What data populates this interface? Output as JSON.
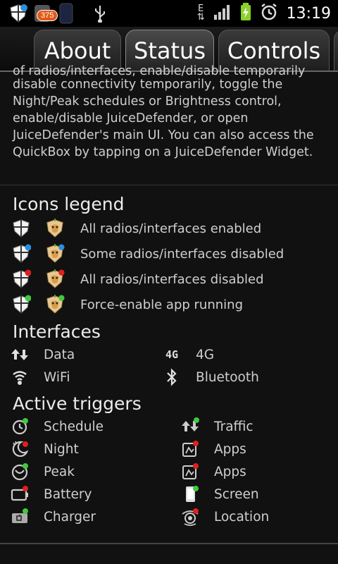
{
  "status_bar": {
    "notification_badge": "375",
    "time": "13:19",
    "network_type": "E"
  },
  "tabs": [
    {
      "label": "About",
      "active": false
    },
    {
      "label": "Status",
      "active": true
    },
    {
      "label": "Controls",
      "active": false
    }
  ],
  "intro": {
    "cut_line": "of radios/interfaces, enable/disable temporarily",
    "text": "disable connectivity temporarily, toggle the Night/Peak schedules or Brightness control, enable/disable JuiceDefender, or open JuiceDefender's main UI. You can also access the QuickBox by tapping on a JuiceDefender Widget."
  },
  "icons_legend": {
    "title": "Icons legend",
    "rows": [
      {
        "label": "All radios/interfaces enabled",
        "dot": ""
      },
      {
        "label": "Some radios/interfaces disabled",
        "dot": "#2a8fe0"
      },
      {
        "label": "All radios/interfaces disabled",
        "dot": "#e02020"
      },
      {
        "label": "Force-enable app running",
        "dot": "#3fc93f"
      }
    ]
  },
  "interfaces": {
    "title": "Interfaces",
    "items": [
      {
        "label": "Data",
        "icon": "data-arrows-icon"
      },
      {
        "label": "4G",
        "icon": "4g-icon"
      },
      {
        "label": "WiFi",
        "icon": "wifi-icon"
      },
      {
        "label": "Bluetooth",
        "icon": "bluetooth-icon"
      }
    ],
    "icon_4g_text": "4G"
  },
  "active_triggers": {
    "title": "Active triggers",
    "items": [
      {
        "label": "Schedule",
        "icon": "clock-icon"
      },
      {
        "label": "Traffic",
        "icon": "traffic-icon"
      },
      {
        "label": "Night",
        "icon": "moon-icon"
      },
      {
        "label": "Apps",
        "icon": "apps-icon"
      },
      {
        "label": "Peak",
        "icon": "peak-icon"
      },
      {
        "label": "Apps",
        "icon": "apps-icon"
      },
      {
        "label": "Battery",
        "icon": "battery-icon"
      },
      {
        "label": "Screen",
        "icon": "screen-icon"
      },
      {
        "label": "Charger",
        "icon": "charger-icon"
      },
      {
        "label": "Location",
        "icon": "location-icon"
      }
    ]
  },
  "colors": {
    "background": "#111111",
    "dot_blue": "#2a8fe0",
    "dot_red": "#e02020",
    "dot_green": "#3fc93f",
    "battery_green": "#8ad12a"
  }
}
